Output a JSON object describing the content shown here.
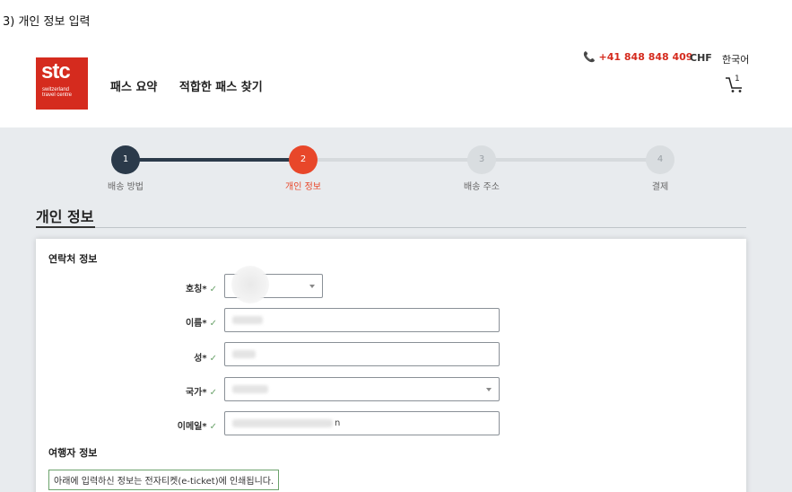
{
  "caption": "3) 개인 정보 입력",
  "header": {
    "logo": {
      "main": "stc",
      "sub": "switzerland travel centre"
    },
    "nav": [
      "패스 요약",
      "적합한 패스 찾기"
    ],
    "phone": "+41 848 848 409",
    "currency": "CHF",
    "language": "한국어",
    "cart_count": "1"
  },
  "steps": [
    {
      "number": "1",
      "label": "배송 방법",
      "state": "done"
    },
    {
      "number": "2",
      "label": "개인 정보",
      "state": "active"
    },
    {
      "number": "3",
      "label": "배송 주소",
      "state": "todo"
    },
    {
      "number": "4",
      "label": "결제",
      "state": "todo"
    }
  ],
  "section_title": "개인 정보",
  "contact": {
    "heading": "연락처 정보",
    "fields": {
      "title": {
        "label": "호칭*",
        "check": "✓"
      },
      "first_name": {
        "label": "이름*",
        "check": "✓"
      },
      "last_name": {
        "label": "성*",
        "check": "✓"
      },
      "country": {
        "label": "국가*",
        "check": "✓"
      },
      "email": {
        "label": "이메일*",
        "check": "✓",
        "visible_tail": "n"
      }
    }
  },
  "traveler": {
    "heading": "여행자 정보",
    "notice": "아래에 입력하신 정보는 전자티켓(e-ticket)에 인쇄됩니다."
  },
  "colors": {
    "brand_red": "#d52b1e",
    "active_step": "#e8472a",
    "done_step": "#2b3a4a",
    "success_green": "#6ca36c"
  }
}
